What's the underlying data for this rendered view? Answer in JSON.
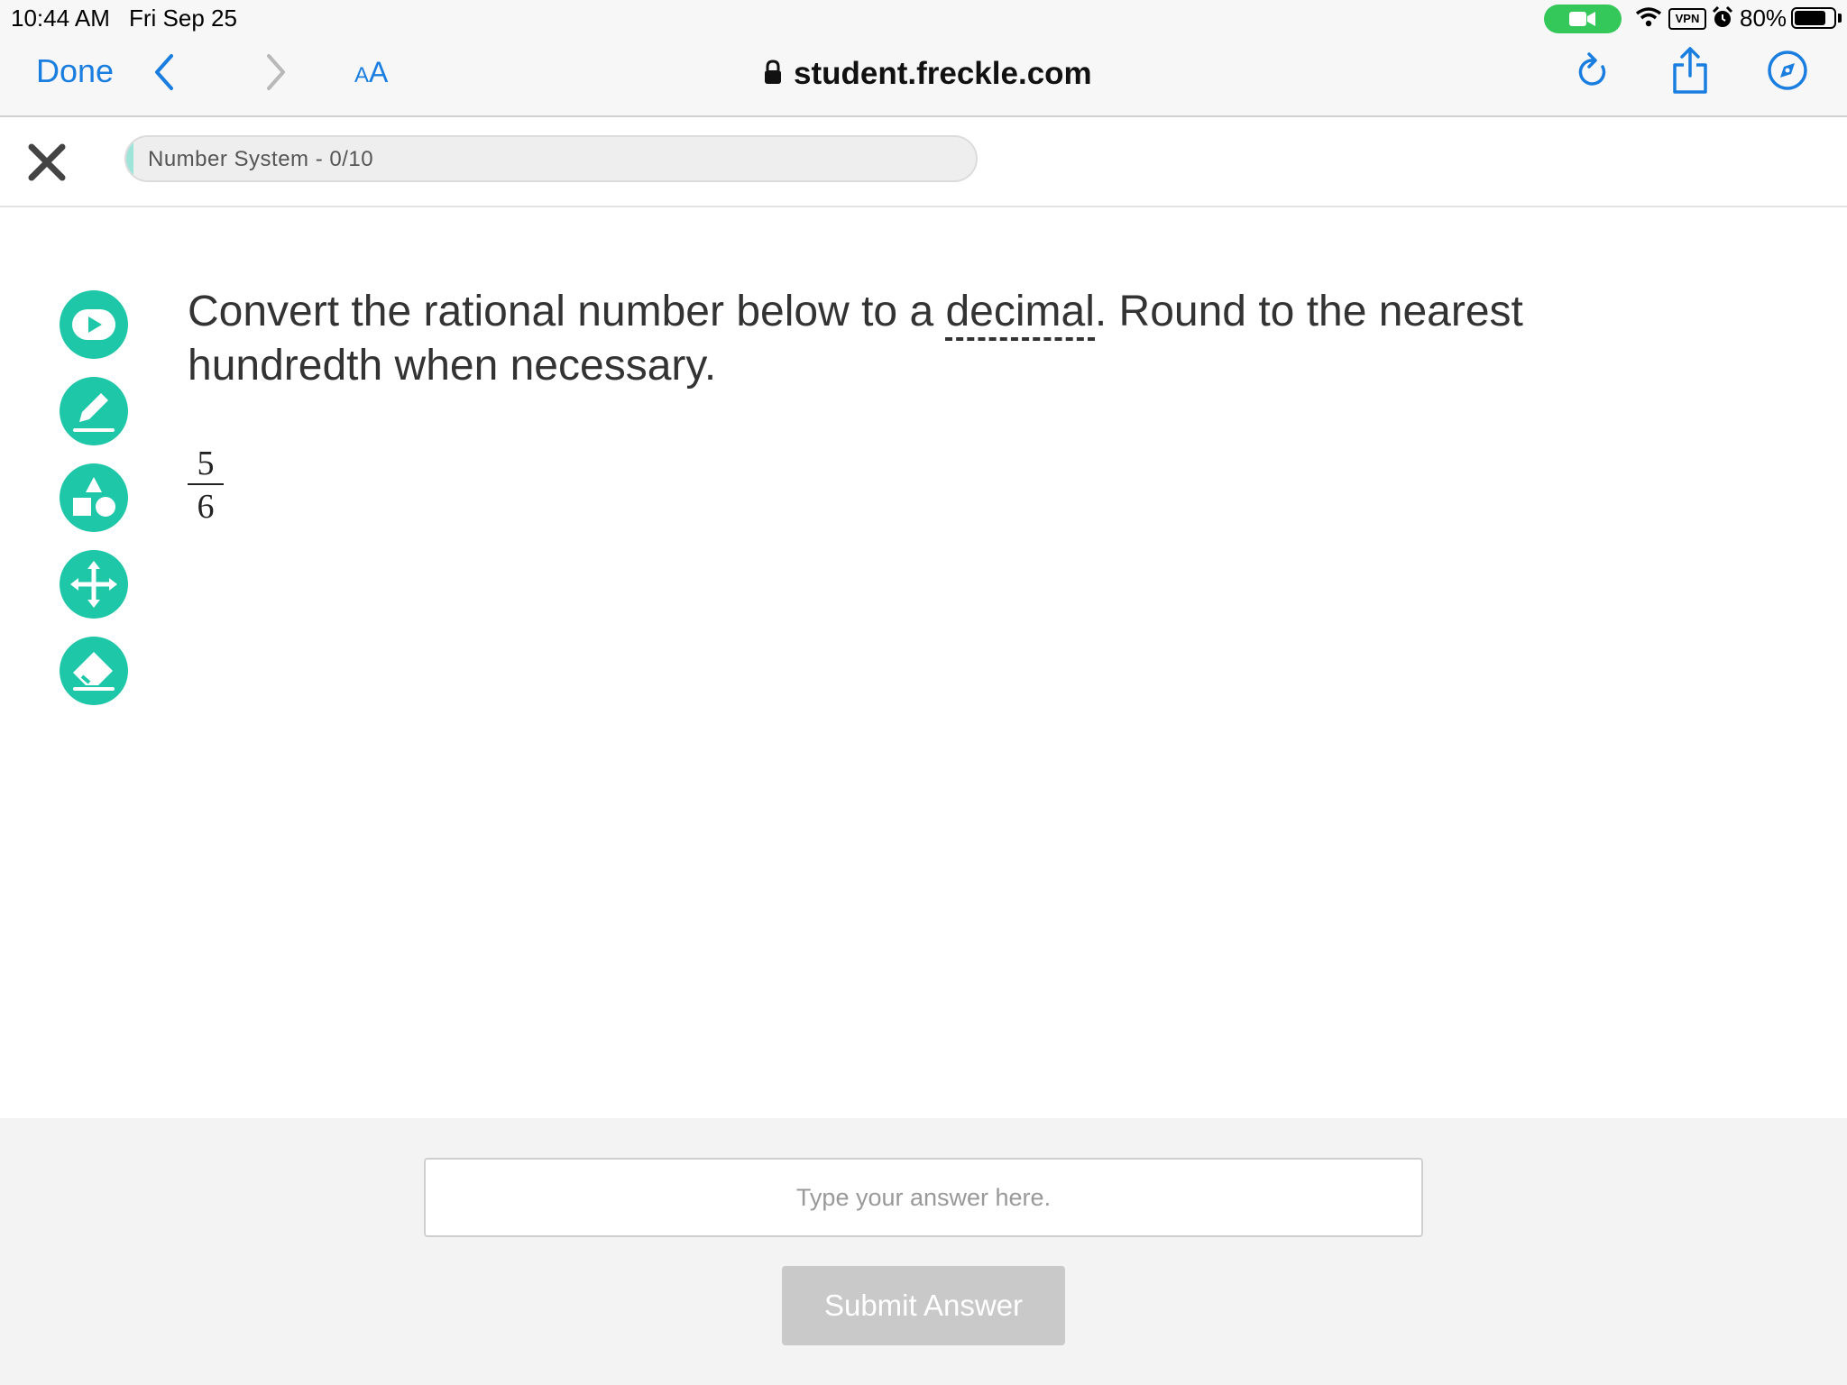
{
  "status_bar": {
    "time": "10:44 AM",
    "date": "Fri Sep 25",
    "vpn_label": "VPN",
    "battery_percent": "80%",
    "battery_level": 0.8,
    "icons": [
      "facetime-camera-icon",
      "wifi-icon",
      "vpn-icon",
      "alarm-icon",
      "battery-icon"
    ]
  },
  "browser": {
    "done_label": "Done",
    "text_size_small": "A",
    "text_size_large": "A",
    "url": "student.freckle.com",
    "icons": [
      "back-chevron-icon",
      "forward-chevron-icon",
      "lock-icon",
      "reload-icon",
      "share-icon",
      "compass-icon"
    ]
  },
  "header": {
    "progress_label": "Number System - 0/10",
    "progress_fraction": 0
  },
  "tools": [
    "video-play-icon",
    "pencil-icon",
    "shapes-icon",
    "move-arrows-icon",
    "eraser-icon"
  ],
  "question": {
    "text_before": "Convert the rational number below to a ",
    "term": "decimal",
    "text_after": ". Round to the nearest hundredth when necessary.",
    "numerator": "5",
    "denominator": "6"
  },
  "answer": {
    "placeholder": "Type your answer here.",
    "value": "",
    "submit_label": "Submit Answer"
  },
  "colors": {
    "accent_teal": "#1ec7a8",
    "link_blue": "#1a7ee0",
    "facetime_green": "#34c759",
    "submit_disabled": "#c9c9c9"
  }
}
